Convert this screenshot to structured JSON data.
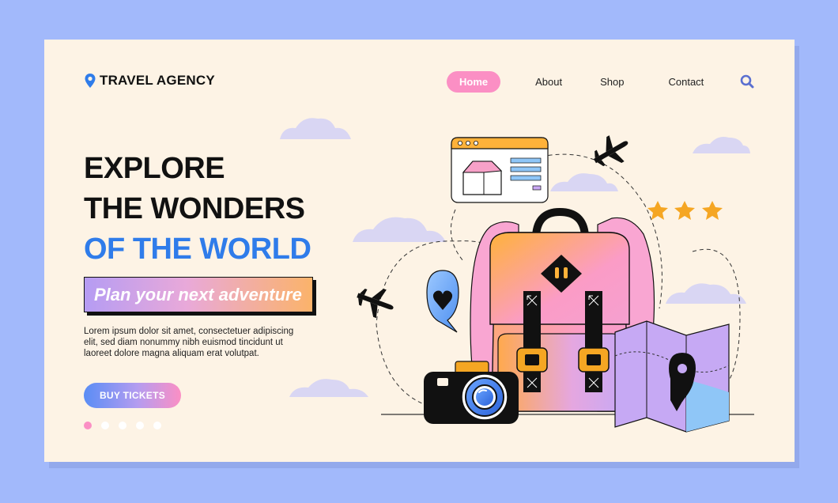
{
  "brand": {
    "name": "TRAVEL AGENCY",
    "icon": "location-pin-icon"
  },
  "nav": {
    "items": [
      {
        "label": "Home",
        "active": true
      },
      {
        "label": "About",
        "active": false
      },
      {
        "label": "Shop",
        "active": false
      },
      {
        "label": "Contact",
        "active": false
      }
    ],
    "search_icon": "search-icon"
  },
  "hero": {
    "line1": "EXPLORE",
    "line2": "THE WONDERS",
    "line3": "OF THE WORLD",
    "tagline": "Plan your next adventure",
    "body": "Lorem ipsum dolor sit amet, consectetuer adipiscing elit, sed diam nonummy nibh euismod tincidunt ut laoreet dolore magna aliquam erat volutpat.",
    "cta_label": "BUY TICKETS"
  },
  "carousel": {
    "slides": 5,
    "active_index": 0
  },
  "colors": {
    "page_bg": "#a2b9fb",
    "card_bg": "#fdf3e5",
    "accent_pink": "#fb8fc4",
    "accent_blue": "#2f7cea",
    "accent_orange": "#fbb36a",
    "accent_purple": "#b59cf3",
    "star_gold": "#f5a623"
  },
  "illustration": {
    "icons": [
      "browser-window-icon",
      "airplane-icon",
      "star-icon",
      "backpack-icon",
      "heart-chat-icon",
      "camera-icon",
      "folded-map-icon",
      "cloud-icon"
    ]
  }
}
